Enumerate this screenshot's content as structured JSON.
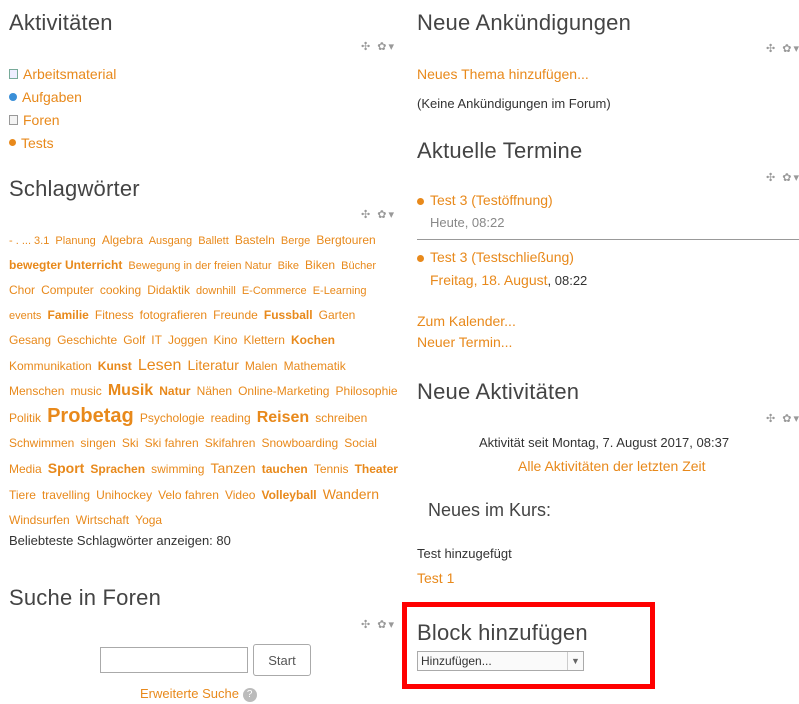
{
  "left": {
    "aktivitaeten": {
      "title": "Aktivitäten",
      "items": [
        {
          "label": "Arbeitsmaterial",
          "icon": "resource-icon"
        },
        {
          "label": "Aufgaben",
          "icon": "assignment-icon"
        },
        {
          "label": "Foren",
          "icon": "forum-icon"
        },
        {
          "label": "Tests",
          "icon": "quiz-icon"
        }
      ]
    },
    "schlagwoerter": {
      "title": "Schlagwörter",
      "tags": [
        {
          "t": "- . ... 3.1",
          "w": 1
        },
        {
          "t": "Planung",
          "w": 1
        },
        {
          "t": "Algebra",
          "w": 2
        },
        {
          "t": "Ausgang",
          "w": 1
        },
        {
          "t": "Ballett",
          "w": 1
        },
        {
          "t": "Basteln",
          "w": 2
        },
        {
          "t": "Berge",
          "w": 1
        },
        {
          "t": "Bergtouren",
          "w": 2
        },
        {
          "t": "bewegter Unterricht",
          "w": 2,
          "b": true
        },
        {
          "t": "Bewegung in der freien Natur",
          "w": 1
        },
        {
          "t": "Bike",
          "w": 1
        },
        {
          "t": "Biken",
          "w": 2
        },
        {
          "t": "Bücher",
          "w": 1
        },
        {
          "t": "Chor",
          "w": 2
        },
        {
          "t": "Computer",
          "w": 2
        },
        {
          "t": "cooking",
          "w": 2
        },
        {
          "t": "Didaktik",
          "w": 2
        },
        {
          "t": "downhill",
          "w": 1
        },
        {
          "t": "E-Commerce",
          "w": 1
        },
        {
          "t": "E-Learning",
          "w": 1
        },
        {
          "t": "events",
          "w": 1
        },
        {
          "t": "Familie",
          "w": 2,
          "b": true
        },
        {
          "t": "Fitness",
          "w": 2
        },
        {
          "t": "fotografieren",
          "w": 2
        },
        {
          "t": "Freunde",
          "w": 2
        },
        {
          "t": "Fussball",
          "w": 2,
          "b": true
        },
        {
          "t": "Garten",
          "w": 2
        },
        {
          "t": "Gesang",
          "w": 2
        },
        {
          "t": "Geschichte",
          "w": 2
        },
        {
          "t": "Golf",
          "w": 2
        },
        {
          "t": "IT",
          "w": 2
        },
        {
          "t": "Joggen",
          "w": 2
        },
        {
          "t": "Kino",
          "w": 2
        },
        {
          "t": "Klettern",
          "w": 2
        },
        {
          "t": "Kochen",
          "w": 2,
          "b": true
        },
        {
          "t": "Kommunikation",
          "w": 2
        },
        {
          "t": "Kunst",
          "w": 2,
          "b": true
        },
        {
          "t": "Lesen",
          "w": 4
        },
        {
          "t": "Literatur",
          "w": 3
        },
        {
          "t": "Malen",
          "w": 2
        },
        {
          "t": "Mathematik",
          "w": 2
        },
        {
          "t": "Menschen",
          "w": 2
        },
        {
          "t": "music",
          "w": 2
        },
        {
          "t": "Musik",
          "w": 4,
          "b": true
        },
        {
          "t": "Natur",
          "w": 2,
          "b": true
        },
        {
          "t": "Nähen",
          "w": 2
        },
        {
          "t": "Online-Marketing",
          "w": 2
        },
        {
          "t": "Philosophie",
          "w": 2
        },
        {
          "t": "Politik",
          "w": 2
        },
        {
          "t": "Probetag",
          "w": 5,
          "b": true
        },
        {
          "t": "Psychologie",
          "w": 2
        },
        {
          "t": "reading",
          "w": 2
        },
        {
          "t": "Reisen",
          "w": 4,
          "b": true
        },
        {
          "t": "schreiben",
          "w": 2
        },
        {
          "t": "Schwimmen",
          "w": 2
        },
        {
          "t": "singen",
          "w": 2
        },
        {
          "t": "Ski",
          "w": 2
        },
        {
          "t": "Ski fahren",
          "w": 2
        },
        {
          "t": "Skifahren",
          "w": 2
        },
        {
          "t": "Snowboarding",
          "w": 2
        },
        {
          "t": "Social Media",
          "w": 2
        },
        {
          "t": "Sport",
          "w": 3,
          "b": true
        },
        {
          "t": "Sprachen",
          "w": 2,
          "b": true
        },
        {
          "t": "swimming",
          "w": 2
        },
        {
          "t": "Tanzen",
          "w": 3
        },
        {
          "t": "tauchen",
          "w": 2,
          "b": true
        },
        {
          "t": "Tennis",
          "w": 2
        },
        {
          "t": "Theater",
          "w": 2,
          "b": true
        },
        {
          "t": "Tiere",
          "w": 2
        },
        {
          "t": "travelling",
          "w": 2
        },
        {
          "t": "Unihockey",
          "w": 2
        },
        {
          "t": "Velo fahren",
          "w": 2
        },
        {
          "t": "Video",
          "w": 2
        },
        {
          "t": "Volleyball",
          "w": 2,
          "b": true
        },
        {
          "t": "Wandern",
          "w": 3
        },
        {
          "t": "Windsurfen",
          "w": 2
        },
        {
          "t": "Wirtschaft",
          "w": 2
        },
        {
          "t": "Yoga",
          "w": 2
        }
      ],
      "show_popular": "Beliebteste Schlagwörter anzeigen: 80"
    },
    "suche": {
      "title": "Suche in Foren",
      "input_value": "",
      "button": "Start",
      "advanced": "Erweiterte Suche",
      "help": "?"
    }
  },
  "right": {
    "ankuendigungen": {
      "title": "Neue Ankündigungen",
      "add_link": "Neues Thema hinzufügen...",
      "empty": "(Keine Ankündigungen im Forum)"
    },
    "termine": {
      "title": "Aktuelle Termine",
      "events": [
        {
          "name": "Test 3 (Testöffnung)",
          "date": "Heute, 08:22",
          "date_link": "",
          "time": ""
        },
        {
          "name": "Test 3 (Testschließung)",
          "date": "",
          "date_link": "Freitag, 18. August",
          "time": ", 08:22"
        }
      ],
      "calendar_link": "Zum Kalender...",
      "new_event_link": "Neuer Termin..."
    },
    "neue_aktivitaeten": {
      "title": "Neue Aktivitäten",
      "since": "Aktivität seit Montag, 7. August 2017, 08:37",
      "all_link": "Alle Aktivitäten der letzten Zeit",
      "sub_title": "Neues im Kurs:",
      "added": "Test hinzugefügt",
      "item_link": "Test 1"
    },
    "block_hinzufuegen": {
      "title": "Block hinzufügen",
      "select_value": "Hinzufügen..."
    }
  },
  "controls": "✣ ✿▾",
  "colors": {
    "link": "#e8891b",
    "highlight": "#ff0000"
  }
}
